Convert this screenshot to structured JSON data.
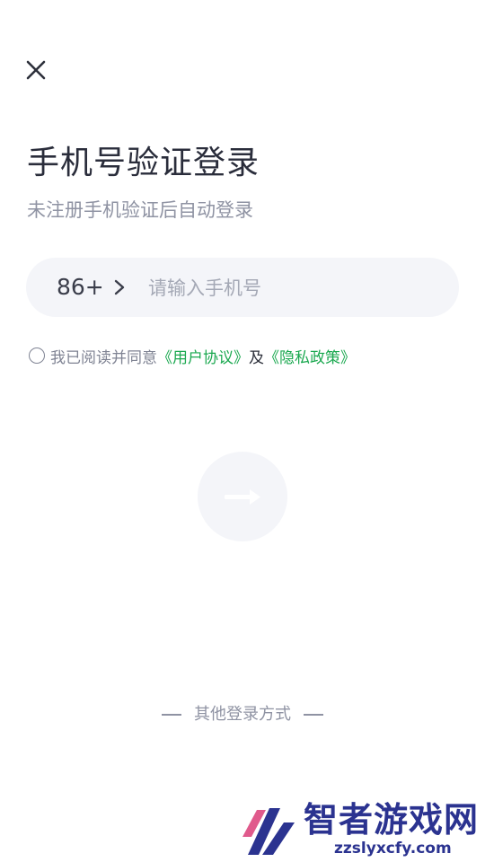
{
  "header": {
    "close_icon": "close-icon"
  },
  "login": {
    "title": "手机号验证登录",
    "subtitle": "未注册手机验证后自动登录"
  },
  "phone": {
    "country_code": "86+",
    "chevron_icon": "chevron-right-icon",
    "value": "",
    "placeholder": "请输入手机号"
  },
  "agreement": {
    "checked": false,
    "prefix": "我已阅读并同意",
    "user_agreement": "《用户协议》",
    "and": "及",
    "privacy_policy": "《隐私政策》"
  },
  "submit": {
    "icon": "arrow-right-icon"
  },
  "other_login": {
    "label": "其他登录方式"
  },
  "watermark": {
    "title": "智者游戏网",
    "domain": "zzslyxcfy.com"
  },
  "colors": {
    "accent_green": "#1aa84f",
    "input_bg": "#f4f5f9",
    "muted_text": "#8f93a3"
  }
}
